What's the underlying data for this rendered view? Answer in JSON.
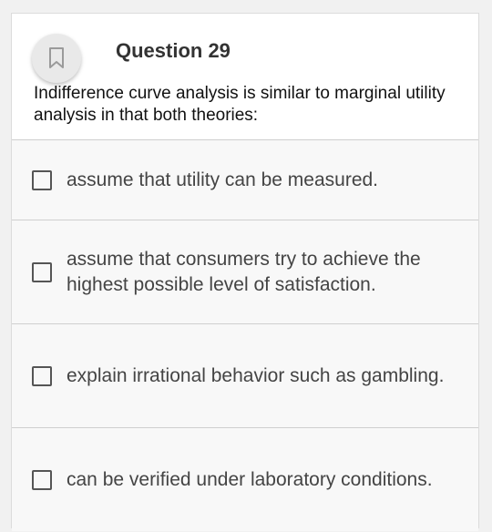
{
  "question": {
    "title": "Question 29",
    "text": "Indifference curve analysis is similar to marginal utility analysis in that both theories:",
    "bookmark_icon": "bookmark-icon"
  },
  "options": [
    {
      "label": "assume that utility can be measured.",
      "checked": false
    },
    {
      "label": "assume that consumers try to achieve the highest possible level of satisfaction.",
      "checked": false
    },
    {
      "label": "explain irrational behavior such as gambling.",
      "checked": false
    },
    {
      "label": "can be verified under laboratory conditions.",
      "checked": false
    }
  ],
  "colors": {
    "background": "#f1f1f1",
    "card": "#ffffff",
    "option_bg": "#f8f8f8",
    "divider": "#cfcfcf"
  }
}
